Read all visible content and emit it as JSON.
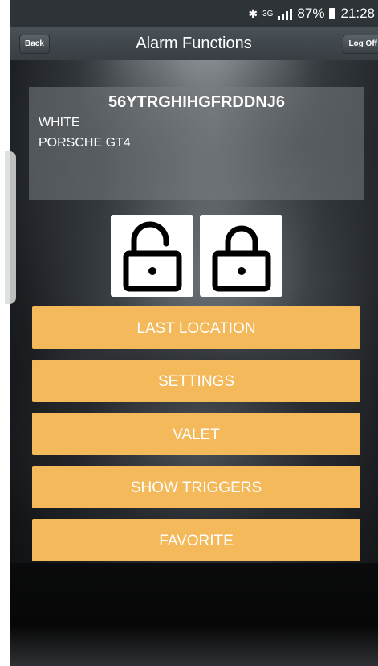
{
  "status_bar": {
    "bluetooth_icon": "bluetooth-icon",
    "network_type": "3G",
    "battery_percent": "87%",
    "time": "21:28"
  },
  "nav": {
    "title": "Alarm Functions",
    "back_label": "Back",
    "logoff_label": "Log Off"
  },
  "vehicle": {
    "vin": "56YTRGHIHGFRDDNJ6",
    "color": "WHITE",
    "model": "PORSCHE  GT4"
  },
  "locks": [
    {
      "icon": "unlock-icon"
    },
    {
      "icon": "lock-icon"
    }
  ],
  "actions": [
    {
      "label": "LAST LOCATION"
    },
    {
      "label": "SETTINGS"
    },
    {
      "label": "VALET"
    },
    {
      "label": "SHOW TRIGGERS"
    },
    {
      "label": "FAVORITE"
    }
  ],
  "colors": {
    "accent": "#f3b95a",
    "nav_bar": "#3d4348",
    "status_bar": "#2e3338"
  }
}
